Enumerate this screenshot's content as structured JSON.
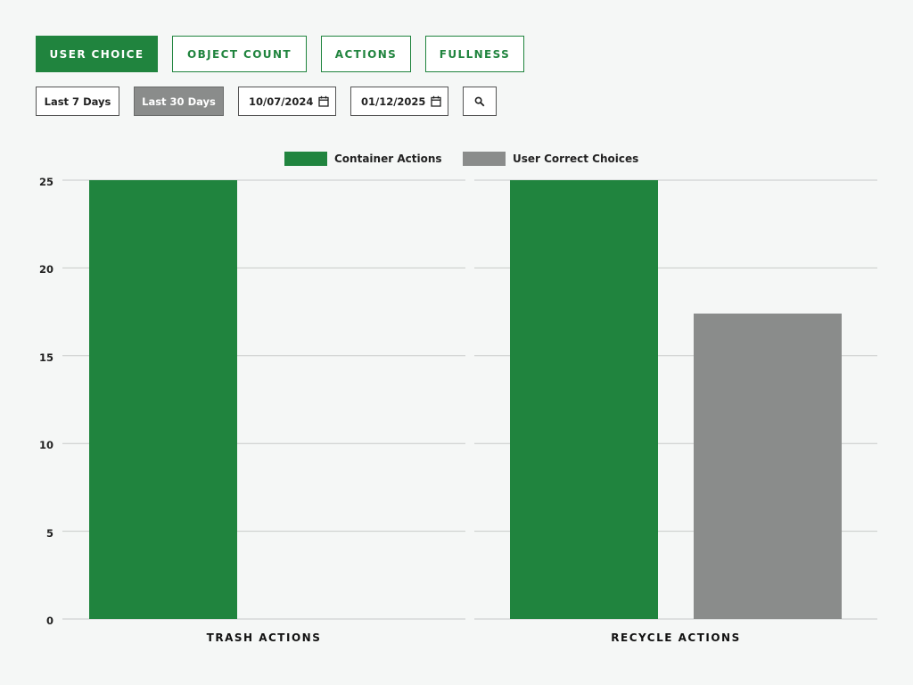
{
  "tabs": [
    {
      "label": "USER CHOICE",
      "active": true
    },
    {
      "label": "OBJECT COUNT",
      "active": false
    },
    {
      "label": "ACTIONS",
      "active": false
    },
    {
      "label": "FULLNESS",
      "active": false
    }
  ],
  "filters": {
    "last7_label": "Last 7 Days",
    "last30_label": "Last 30 Days",
    "last30_active": true,
    "start_date": "10/07/2024",
    "end_date": "01/12/2025",
    "calendar_icon": "calendar-icon",
    "search_icon": "search-icon"
  },
  "colors": {
    "accent": "#20843e",
    "secondary": "#8a8c8b",
    "grid": "#c8cac9"
  },
  "chart_data": {
    "type": "bar",
    "categories": [
      "TRASH ACTIONS",
      "RECYCLE ACTIONS"
    ],
    "series": [
      {
        "name": "Container Actions",
        "values": [
          25,
          25
        ],
        "color": "#20843e"
      },
      {
        "name": "User Correct Choices",
        "values": [
          0,
          17.4
        ],
        "color": "#8a8c8b"
      }
    ],
    "ylim": [
      0,
      25
    ],
    "yticks": [
      "0",
      "5",
      "10",
      "15",
      "20",
      "25"
    ],
    "grid": true,
    "legend_position": "top-center"
  }
}
